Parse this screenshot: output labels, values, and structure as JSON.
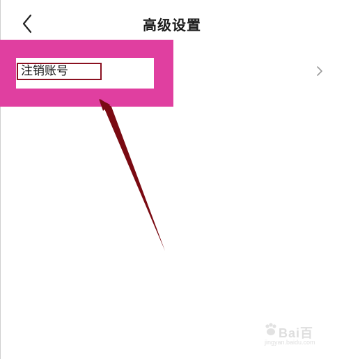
{
  "header": {
    "title": "高级设置",
    "back_icon": "chevron-left-icon"
  },
  "settings_list": {
    "items": [
      {
        "label": "注销账号",
        "icon": "chevron-right-icon"
      }
    ]
  },
  "annotation": {
    "highlight_color": "#e03fa0",
    "box_color": "#8a1020",
    "arrow_color": "#7a0a12"
  },
  "watermark": {
    "text": "Bai百",
    "sub": "jingyan.baidu.com"
  }
}
